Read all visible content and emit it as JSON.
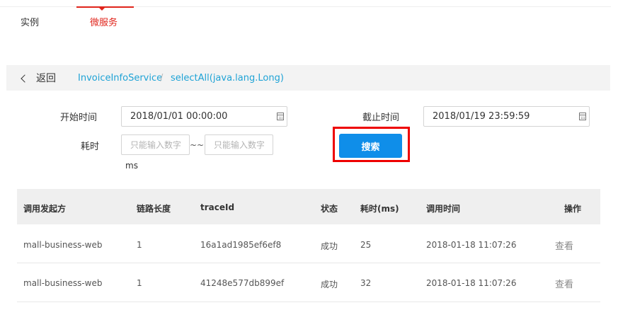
{
  "tabs": [
    {
      "label": "实例",
      "active": false
    },
    {
      "label": "微服务",
      "active": true
    }
  ],
  "colors": {
    "accent_red": "#e0241b",
    "link_blue": "#1fa3d6",
    "button_blue": "#0f8ee9",
    "highlight_red": "#ee0000"
  },
  "breadcrumb": {
    "back_label": "返回",
    "service": "InvoiceInfoService",
    "separator": "/",
    "method": "selectAll(java.lang.Long)"
  },
  "filters": {
    "start_label": "开始时间",
    "start_value": "2018/01/01 00:00:00",
    "end_label": "截止时间",
    "end_value": "2018/01/19 23:59:59",
    "duration_label": "耗时",
    "duration_min_placeholder": "只能输入数字",
    "duration_sep": "~~",
    "duration_max_placeholder": "只能输入数字",
    "unit": "ms",
    "search_label": "搜索"
  },
  "table": {
    "columns": [
      "调用发起方",
      "链路长度",
      "traceId",
      "状态",
      "耗时(ms)",
      "调用时间",
      "操作"
    ],
    "rows": [
      {
        "caller": "mall-business-web",
        "length": "1",
        "trace_id": "16a1ad1985ef6ef8",
        "status": "成功",
        "duration": "25",
        "time": "2018-01-18 11:07:26",
        "action": "查看"
      },
      {
        "caller": "mall-business-web",
        "length": "1",
        "trace_id": "41248e577db899ef",
        "status": "成功",
        "duration": "32",
        "time": "2018-01-18 11:07:26",
        "action": "查看"
      }
    ]
  }
}
